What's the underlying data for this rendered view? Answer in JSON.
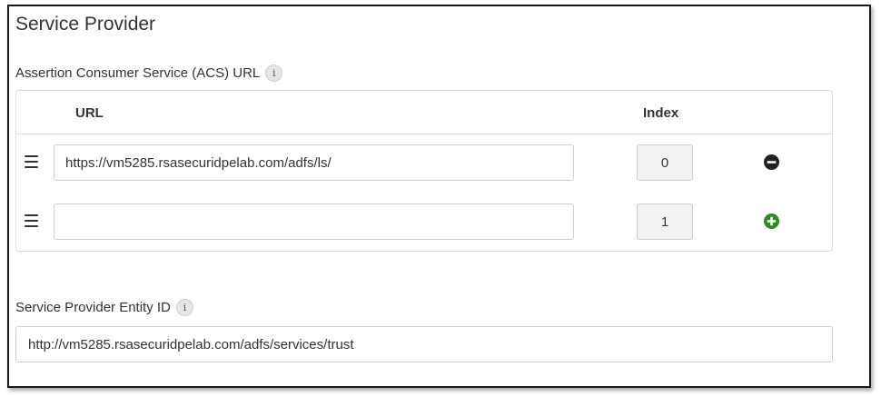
{
  "section": {
    "title": "Service Provider"
  },
  "acs": {
    "label": "Assertion Consumer Service (ACS) URL",
    "info_glyph": "i",
    "headers": {
      "url": "URL",
      "index": "Index"
    },
    "rows": [
      {
        "url": "https://vm5285.rsasecuridpelab.com/adfs/ls/",
        "index": "0",
        "action_icon": "remove-circle-icon",
        "action_color": "#222222"
      },
      {
        "url": "",
        "index": "1",
        "action_icon": "add-circle-icon",
        "action_color": "#2e8b22"
      }
    ]
  },
  "entity": {
    "label": "Service Provider Entity ID",
    "info_glyph": "i",
    "value": "http://vm5285.rsasecuridpelab.com/adfs/services/trust"
  }
}
